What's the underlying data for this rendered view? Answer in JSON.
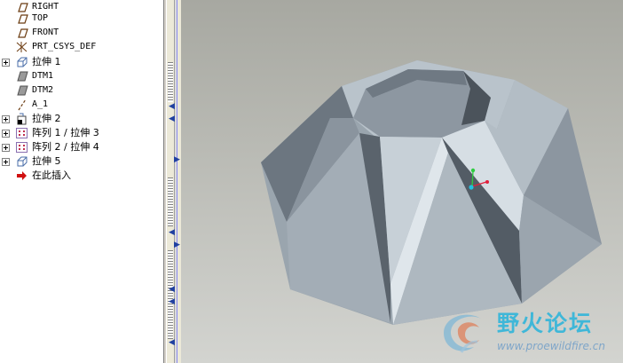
{
  "model_tree": {
    "items": [
      {
        "label": "RIGHT",
        "icon": "datum-plane-icon",
        "expandable": false
      },
      {
        "label": "TOP",
        "icon": "datum-plane-icon",
        "expandable": false
      },
      {
        "label": "FRONT",
        "icon": "datum-plane-icon",
        "expandable": false
      },
      {
        "label": "PRT_CSYS_DEF",
        "icon": "coordinate-system-icon",
        "expandable": false
      },
      {
        "label": "拉伸 1",
        "icon": "extrude-icon",
        "expandable": true
      },
      {
        "label": "DTM1",
        "icon": "datum-plane-shaded-icon",
        "expandable": false
      },
      {
        "label": "DTM2",
        "icon": "datum-plane-shaded-icon",
        "expandable": false
      },
      {
        "label": "A_1",
        "icon": "datum-axis-icon",
        "expandable": false
      },
      {
        "label": "拉伸 2",
        "icon": "extrude-cut-icon",
        "expandable": true
      },
      {
        "label": "阵列 1 / 拉伸 3",
        "icon": "pattern-icon",
        "expandable": true
      },
      {
        "label": "阵列 2 / 拉伸 4",
        "icon": "pattern-icon",
        "expandable": true
      },
      {
        "label": "拉伸 5",
        "icon": "extrude-icon",
        "expandable": true
      },
      {
        "label": "在此插入",
        "icon": "insert-here-arrow-icon",
        "expandable": false
      }
    ]
  },
  "viewport": {
    "background_top": "#a7a8a1",
    "background_bottom": "#d3d4d0",
    "model_color": "#a4aeb6"
  },
  "watermark": {
    "title": "野火论坛",
    "url": "www.proewildfire.cn"
  }
}
